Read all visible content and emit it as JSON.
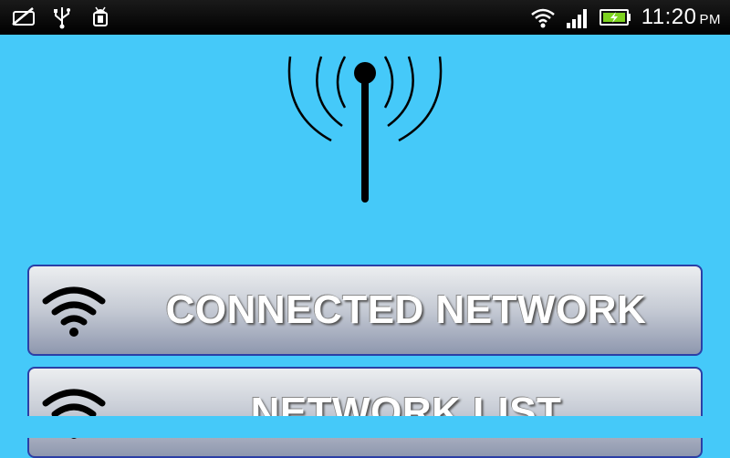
{
  "status_bar": {
    "time": "11:20",
    "ampm": "PM",
    "icons_left": [
      "no-sim-icon",
      "usb-icon",
      "android-debug-icon"
    ],
    "icons_right": [
      "wifi-icon",
      "signal-icon",
      "battery-charging-icon"
    ]
  },
  "main": {
    "tower_icon": "antenna-tower-icon",
    "buttons": [
      {
        "label": "CONNECTED NETWORK",
        "icon": "wifi-icon"
      },
      {
        "label": "NETWORK LIST",
        "icon": "wifi-icon"
      }
    ]
  },
  "colors": {
    "background": "#45c9f9",
    "button_border": "#2b3fa6",
    "status_bar": "#000000"
  }
}
